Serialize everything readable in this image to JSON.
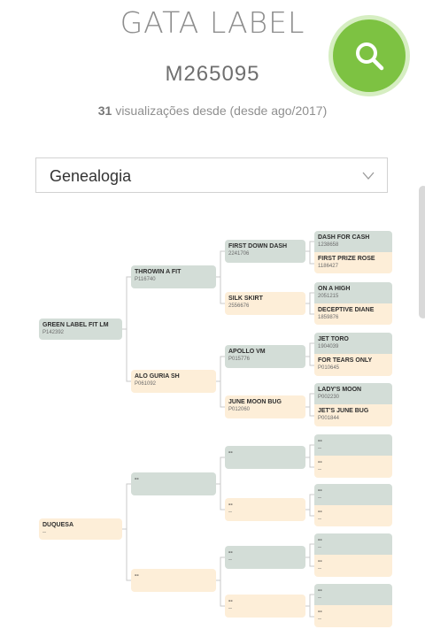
{
  "header": {
    "title": "GATA LABEL",
    "registration": "M265095",
    "views_count": "31",
    "views_text": "visualizações desde  (desde ago/2017)",
    "search_icon": "search-icon",
    "accent_color": "#7dc242"
  },
  "section_select": {
    "value": "Genealogia",
    "icon": "chevron-down-icon"
  },
  "pedigree": {
    "gen1": [
      {
        "name": "GREEN LABEL FIT LM",
        "reg": "P142392",
        "color": "green"
      },
      {
        "name": "DUQUESA",
        "reg": "--",
        "color": "orange"
      }
    ],
    "gen2": [
      {
        "name": "THROWIN A FIT",
        "reg": "P116740",
        "color": "green"
      },
      {
        "name": "ALO GURIA SH",
        "reg": "P061092",
        "color": "orange"
      },
      {
        "name": "--",
        "reg": "",
        "color": "green"
      },
      {
        "name": "--",
        "reg": "",
        "color": "orange"
      }
    ],
    "gen3": [
      {
        "name": "FIRST DOWN DASH",
        "reg": "2241706",
        "color": "green"
      },
      {
        "name": "SILK SKIRT",
        "reg": "2556676",
        "color": "orange"
      },
      {
        "name": "APOLLO VM",
        "reg": "P015776",
        "color": "green"
      },
      {
        "name": "JUNE MOON BUG",
        "reg": "P012060",
        "color": "orange"
      },
      {
        "name": "--",
        "reg": "",
        "color": "green"
      },
      {
        "name": "--",
        "reg": "--",
        "color": "orange"
      },
      {
        "name": "--",
        "reg": "--",
        "color": "green"
      },
      {
        "name": "--",
        "reg": "--",
        "color": "orange"
      }
    ],
    "gen4": [
      {
        "name": "DASH FOR CASH",
        "reg": "1238658"
      },
      {
        "name": "FIRST PRIZE ROSE",
        "reg": "1186427"
      },
      {
        "name": "ON A HIGH",
        "reg": "2051215"
      },
      {
        "name": "DECEPTIVE DIANE",
        "reg": "1859876"
      },
      {
        "name": "JET TORO",
        "reg": "1904039"
      },
      {
        "name": "FOR TEARS ONLY",
        "reg": "P010645"
      },
      {
        "name": "LADY'S MOON",
        "reg": "P002230"
      },
      {
        "name": "JET'S JUNE BUG",
        "reg": "P001844"
      },
      {
        "name": "--",
        "reg": "--"
      },
      {
        "name": "--",
        "reg": "--"
      },
      {
        "name": "--",
        "reg": "--"
      },
      {
        "name": "--",
        "reg": "--"
      },
      {
        "name": "--",
        "reg": "--"
      },
      {
        "name": "--",
        "reg": "--"
      },
      {
        "name": "--",
        "reg": "--"
      },
      {
        "name": "--",
        "reg": "--"
      }
    ]
  }
}
